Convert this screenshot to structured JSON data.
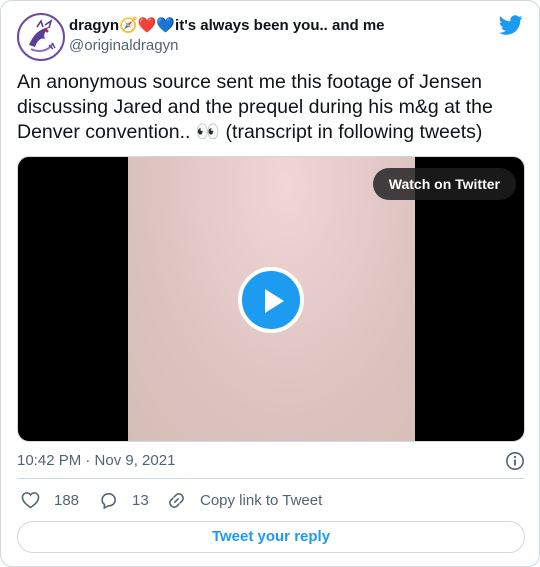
{
  "author": {
    "display_name": "dragyn🧭❤️💙it's always been you.. and me",
    "handle": "@originaldragyn"
  },
  "tweet": {
    "text": "An anonymous source sent me this footage of Jensen discussing Jared and the prequel during his m&g at the Denver convention.. 👀 (transcript in following tweets)"
  },
  "media": {
    "watch_label": "Watch on Twitter"
  },
  "meta": {
    "timestamp": "10:42 PM · Nov 9, 2021"
  },
  "actions": {
    "likes": "188",
    "replies": "13",
    "copy_link": "Copy link to Tweet"
  },
  "reply_button": "Tweet your reply",
  "colors": {
    "accent": "#1d9bf0",
    "muted_text": "#536471",
    "border": "#cfd9de"
  },
  "icons": [
    "twitter-bird-icon",
    "info-icon",
    "heart-icon",
    "reply-bubble-icon",
    "link-icon",
    "play-icon"
  ]
}
